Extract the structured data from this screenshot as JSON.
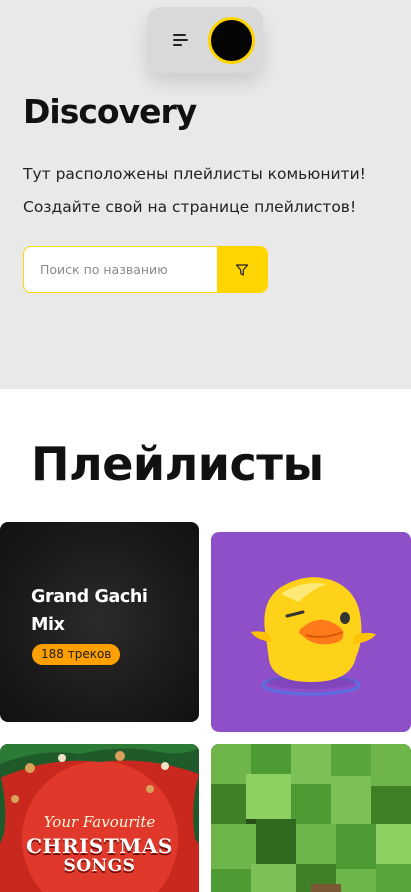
{
  "header": {
    "menu_icon": "menu-icon",
    "avatar_color": "#050505",
    "accent_color": "#ffd500"
  },
  "hero": {
    "title": "Discovery",
    "description_line1": "Тут расположены плейлисты комьюнити!",
    "description_line2": "Создайте свой на странице плейлистов!",
    "search": {
      "placeholder": "Поиск по названию",
      "value": "",
      "filter_icon": "filter-icon"
    }
  },
  "playlists": {
    "title": "Плейлисты",
    "items": [
      {
        "title": "Grand Gachi Mix",
        "count_label": "188 треков"
      },
      {
        "image": "duck-illustration"
      },
      {
        "cover_line1": "Your Favourite",
        "cover_line2": "CHRISTMAS",
        "cover_line3": "SONGS"
      },
      {
        "image": "voxel-grass-blocks"
      }
    ]
  }
}
